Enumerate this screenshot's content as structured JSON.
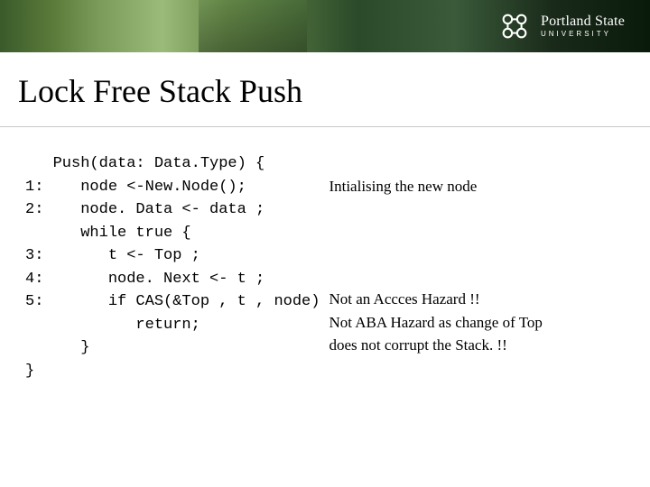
{
  "header": {
    "university_name": "Portland State",
    "university_sub": "UNIVERSITY"
  },
  "title": "Lock Free Stack Push",
  "code": {
    "l0": "   Push(data: Data.Type) {",
    "l1": "1:    node <-New.Node();",
    "l2": "2:    node. Data <- data ;",
    "l3": "      while true {",
    "l4": "3:       t <- Top ;",
    "l5": "4:       node. Next <- t ;",
    "l6": "5:       if CAS(&Top , t , node)",
    "l7": "            return;",
    "l8": "      }",
    "l9": "}"
  },
  "annotations": {
    "a1": "Intialising the new node",
    "a2": "Not an Accces Hazard !!",
    "a3": "Not ABA Hazard as change of Top does not corrupt the Stack. !!"
  }
}
